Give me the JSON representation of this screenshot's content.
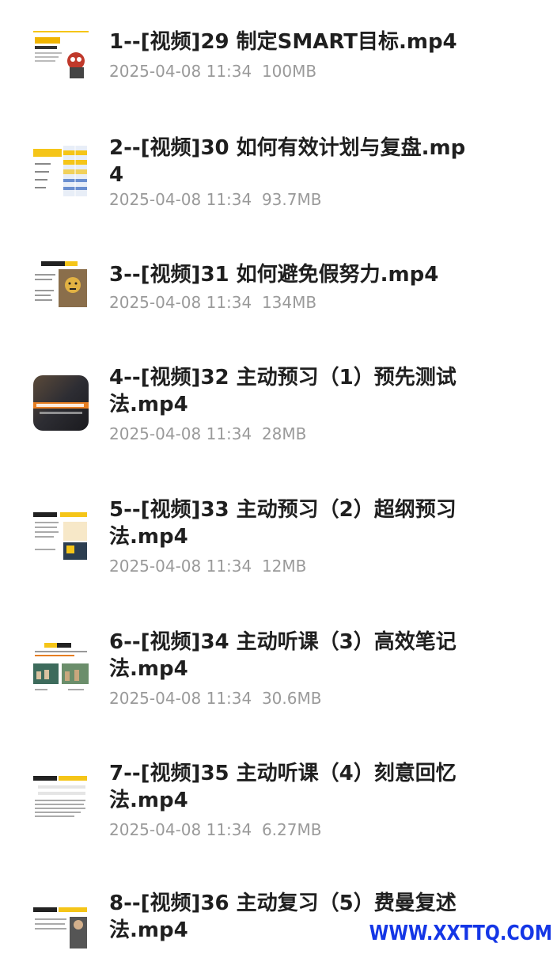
{
  "files": [
    {
      "name": "1--[视频]29 制定SMART目标.mp4",
      "date": "2025-04-08 11:34",
      "size": "100MB",
      "thumb_icon": "slide-thumbnail-yellow-title"
    },
    {
      "name": "2--[视频]30 如何有效计划与复盘.mp\n4",
      "date": "2025-04-08 11:34",
      "size": "93.7MB",
      "thumb_icon": "slide-thumbnail-table"
    },
    {
      "name": "3--[视频]31 如何避免假努力.mp4",
      "date": "2025-04-08 11:34",
      "size": "134MB",
      "thumb_icon": "slide-thumbnail-person"
    },
    {
      "name": "4--[视频]32 主动预习（1）预先测试\n法.mp4",
      "date": "2025-04-08 11:34",
      "size": "28MB",
      "thumb_icon": "video-thumbnail-dark"
    },
    {
      "name": "5--[视频]33 主动预习（2）超纲预习\n法.mp4",
      "date": "2025-04-08 11:34",
      "size": "12MB",
      "thumb_icon": "slide-thumbnail-notes"
    },
    {
      "name": "6--[视频]34 主动听课（3）高效笔记\n法.mp4",
      "date": "2025-04-08 11:34",
      "size": "30.6MB",
      "thumb_icon": "slide-thumbnail-classroom"
    },
    {
      "name": "7--[视频]35 主动听课（4）刻意回忆\n法.mp4",
      "date": "2025-04-08 11:34",
      "size": "6.27MB",
      "thumb_icon": "slide-thumbnail-text"
    },
    {
      "name": "8--[视频]36 主动复习（5）费曼复述\n法.mp4",
      "date": "",
      "size": "",
      "thumb_icon": "slide-thumbnail-portrait"
    }
  ],
  "watermark": "WWW.XXTTQ.COM",
  "colors": {
    "title": "#1f1f1f",
    "meta": "#9a9a9a",
    "watermark": "#1436e6",
    "accent_yellow": "#f5c518"
  }
}
